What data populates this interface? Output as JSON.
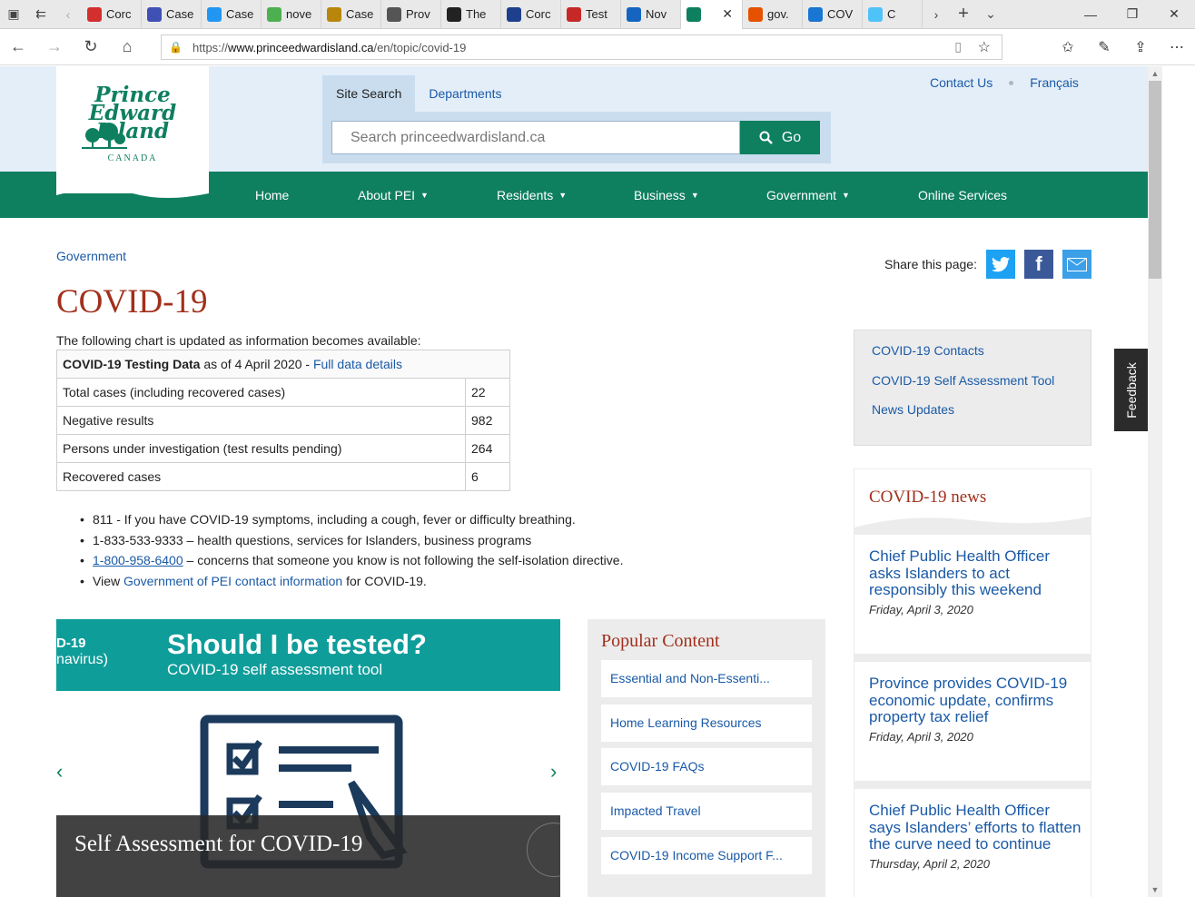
{
  "browser": {
    "tabs": [
      {
        "label": "Corc",
        "fav_color": "#d32f2f",
        "icon": "maple-leaf-icon"
      },
      {
        "label": "Case",
        "fav_color": "#3f51b5",
        "icon": "camera-icon"
      },
      {
        "label": "Case",
        "fav_color": "#2196f3",
        "icon": "chart-icon"
      },
      {
        "label": "nove",
        "fav_color": "#4caf50",
        "icon": "plus-icon"
      },
      {
        "label": "Case",
        "fav_color": "#b8860b",
        "icon": "document-icon"
      },
      {
        "label": "Prov",
        "fav_color": "#555555",
        "icon": "bison-icon"
      },
      {
        "label": "The",
        "fav_color": "#222222",
        "icon": "globe-icon"
      },
      {
        "label": "Corc",
        "fav_color": "#1e3f8c",
        "icon": "fleur-de-lis-icon"
      },
      {
        "label": "Test",
        "fav_color": "#c62828",
        "icon": "pen-icon"
      },
      {
        "label": "Nov",
        "fav_color": "#1565c0",
        "icon": "flag-icon"
      },
      {
        "label": "",
        "fav_color": "#0e7f5f",
        "icon": "pei-tree-icon"
      },
      {
        "label": "gov.",
        "fav_color": "#e65100",
        "icon": "flower-icon"
      },
      {
        "label": "COV",
        "fav_color": "#1976d2",
        "icon": "ontario-icon"
      },
      {
        "label": "C",
        "fav_color": "#4fc3f7",
        "icon": "bc-icon"
      }
    ],
    "url_prefix": "https://",
    "url_host": "www.princeedwardisland.ca",
    "url_path": "/en/topic/covid-19"
  },
  "header": {
    "logo_line1": "Prince",
    "logo_line2": "Edward",
    "logo_line3": "Island",
    "logo_country": "CANADA",
    "search_tab_active": "Site Search",
    "search_tab_other": "Departments",
    "search_placeholder": "Search princeedwardisland.ca",
    "search_button": "Go",
    "contact_link": "Contact Us",
    "french_link": "Français"
  },
  "nav": {
    "home": "Home",
    "about": "About PEI",
    "residents": "Residents",
    "business": "Business",
    "government": "Government",
    "online": "Online Services"
  },
  "main": {
    "breadcrumb": "Government",
    "title": "COVID-19",
    "intro": "The following chart is updated as information becomes available:",
    "table_caption_bold": "COVID-19 Testing Data",
    "table_caption_rest": " as of 4 April 2020 - ",
    "table_caption_link": "Full data details",
    "rows": [
      {
        "label": "Total cases (including recovered cases)",
        "value": "22"
      },
      {
        "label": "Negative results",
        "value": "982"
      },
      {
        "label": "Persons under investigation (test results pending)",
        "value": "264"
      },
      {
        "label": "Recovered cases",
        "value": "6"
      }
    ],
    "bullet1": "811 - If you have COVID-19 symptoms, including a cough, fever or difficulty breathing.",
    "bullet2": "1-833-533-9333 – health questions, services for Islanders, business programs",
    "bullet3_link": "1-800-958-6400",
    "bullet3_rest": " – concerns that someone you know is not following the self-isolation directive.",
    "bullet4_pre": "View ",
    "bullet4_link": "Government of PEI contact information",
    "bullet4_post": " for COVID-19."
  },
  "share": {
    "label": "Share this page:",
    "twitter_color": "#1da1f2",
    "facebook_color": "#3b5998",
    "email_color": "#3ca0e8"
  },
  "sidebar": {
    "links": [
      "COVID-19 Contacts",
      "COVID-19 Self Assessment Tool",
      "News Updates"
    ],
    "news_title": "COVID-19 news",
    "news": [
      {
        "headline": "Chief Public Health Officer asks Islanders to act responsibly this weekend",
        "date": "Friday, April 3, 2020"
      },
      {
        "headline": "Province provides COVID-19 economic update, confirms property tax relief",
        "date": "Friday, April 3, 2020"
      },
      {
        "headline": "Chief Public Health Officer says Islanders’ efforts to flatten the curve need to continue",
        "date": "Thursday, April 2, 2020"
      }
    ]
  },
  "slider": {
    "banner_left1": "D-19",
    "banner_left2": "navirus)",
    "banner_title": "Should I be tested?",
    "banner_sub": "COVID-19 self assessment tool",
    "caption": "Self Assessment for COVID-19"
  },
  "popular": {
    "title": "Popular Content",
    "links": [
      "Essential and Non-Essenti...",
      "Home Learning Resources",
      "COVID-19 FAQs",
      "Impacted Travel",
      "COVID-19 Income Support F..."
    ]
  },
  "feedback": "Feedback",
  "colors": {
    "brand_green": "#0e7f5f",
    "title_red": "#a1301c",
    "link_blue": "#1a5aa6"
  }
}
